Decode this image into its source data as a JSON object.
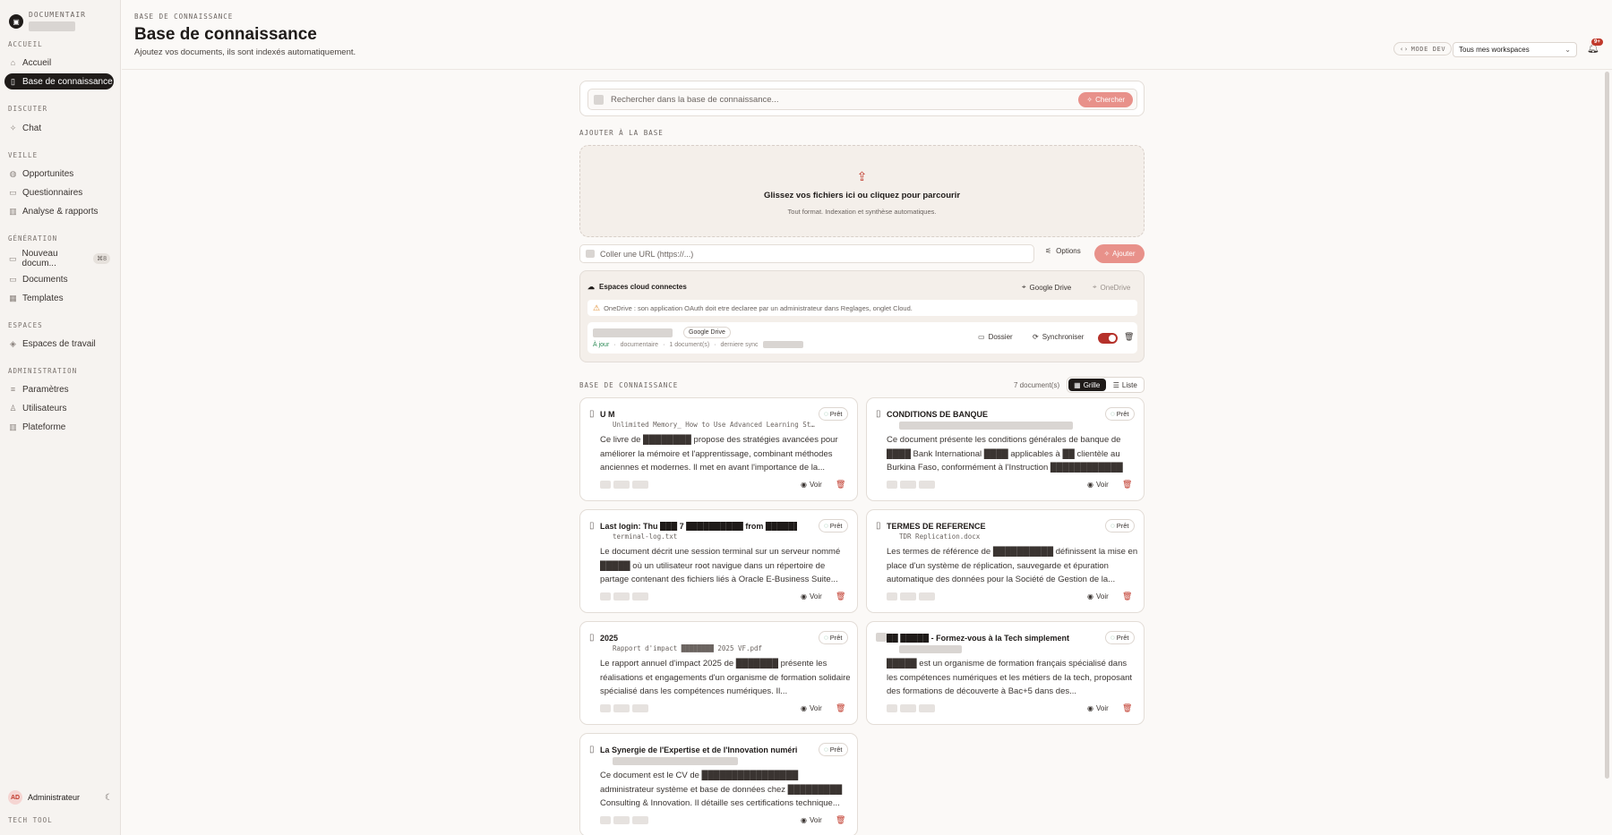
{
  "brand": {
    "name": "DOCUMENTAIR"
  },
  "sidebar": {
    "sections": [
      {
        "label": "ACCUEIL",
        "items": [
          {
            "label": "Accueil",
            "icon": "home-icon"
          },
          {
            "label": "Base de connaissance",
            "icon": "book-icon",
            "active": true
          }
        ]
      },
      {
        "label": "DISCUTER",
        "items": [
          {
            "label": "Chat",
            "icon": "sparkle-icon"
          }
        ]
      },
      {
        "label": "VEILLE",
        "items": [
          {
            "label": "Opportunites",
            "icon": "globe-icon"
          },
          {
            "label": "Questionnaires",
            "icon": "file-icon"
          },
          {
            "label": "Analyse & rapports",
            "icon": "chart-icon"
          }
        ]
      },
      {
        "label": "GÉNÉRATION",
        "items": [
          {
            "label": "Nouveau docum...",
            "icon": "doc-plus-icon",
            "badge": "⌘8"
          },
          {
            "label": "Documents",
            "icon": "file-icon"
          },
          {
            "label": "Templates",
            "icon": "template-icon"
          }
        ]
      },
      {
        "label": "ESPACES",
        "items": [
          {
            "label": "Espaces de travail",
            "icon": "layers-icon"
          }
        ]
      },
      {
        "label": "ADMINISTRATION",
        "items": [
          {
            "label": "Paramètres",
            "icon": "sliders-icon"
          },
          {
            "label": "Utilisateurs",
            "icon": "user-icon"
          },
          {
            "label": "Plateforme",
            "icon": "chart-icon"
          }
        ]
      }
    ],
    "user": {
      "initials": "AD",
      "name": "Administrateur"
    },
    "footer": "TECH TOOL"
  },
  "header": {
    "crumb": "BASE DE CONNAISSANCE",
    "title": "Base de connaissance",
    "subtitle": "Ajoutez vos documents, ils sont indexés automatiquement.",
    "mode_dev": "MODE DEV",
    "workspace": "Tous mes workspaces",
    "notif_badge": "9+"
  },
  "search": {
    "placeholder": "Rechercher dans la base de connaissance...",
    "button": "Chercher"
  },
  "add": {
    "label": "AJOUTER À LA BASE",
    "drop_title": "Glissez vos fichiers ici ou cliquez pour parcourir",
    "drop_sub": "Tout format. Indexation et synthèse automatiques.",
    "url_placeholder": "Coller une URL (https://...)",
    "options": "Options",
    "add_button": "Ajouter"
  },
  "cloud": {
    "title": "Espaces cloud connectes",
    "google_drive": "Google Drive",
    "onedrive": "OneDrive",
    "warning": "OneDrive : son application OAuth doit etre declaree par un administrateur dans Reglages, onglet Cloud.",
    "connection": {
      "tag": "Google Drive",
      "status": "À jour",
      "folder": "documentaire",
      "count": "1 document(s)",
      "last_sync": "derniere sync",
      "dossier": "Dossier",
      "sync": "Synchroniser"
    }
  },
  "kb": {
    "label": "BASE DE CONNAISSANCE",
    "count": "7 document(s)",
    "grid": "Grille",
    "list": "Liste"
  },
  "ui": {
    "badge": "Prêt",
    "voir": "Voir"
  },
  "documents": [
    {
      "title": "U M",
      "file": "Unlimited Memory_ How to Use Advanced Learning St…",
      "desc": "Ce livre de ████████ propose des stratégies avancées pour améliorer la mémoire et l'apprentissage, combinant méthodes anciennes et modernes. Il met en avant l'importance de la..."
    },
    {
      "title": "CONDITIONS DE BANQUE",
      "file": "",
      "desc": "Ce document présente les conditions générales de banque de ████ Bank International ████ applicables à ██ clientèle au Burkina Faso, conformément à l'Instruction ████████████ de..."
    },
    {
      "title": "Last login: Thu ███ 7 ██████████ from █████████",
      "file": "terminal-log.txt",
      "desc": "Le document décrit une session terminal sur un serveur nommé █████ où un utilisateur root navigue dans un répertoire de partage contenant des fichiers liés à Oracle E-Business Suite..."
    },
    {
      "title": "TERMES DE REFERENCE",
      "file": "TDR Replication.docx",
      "desc": "Les termes de référence de ██████████ définissent la mise en place d'un système de réplication, sauvegarde et épuration automatique des données pour la Société de Gestion de la..."
    },
    {
      "title": "2025",
      "file": "Rapport d'impact ████████ 2025 VF.pdf",
      "desc": "Le rapport annuel d'impact 2025 de ███████ présente les réalisations et engagements d'un organisme de formation solidaire spécialisé dans les compétences numériques. Il..."
    },
    {
      "title": "██ █████ - Formez-vous à la Tech simplement",
      "file": "",
      "desc": "█████ est un organisme de formation français spécialisé dans les compétences numériques et les métiers de la tech, proposant des formations de découverte à Bac+5 dans des..."
    },
    {
      "title": "La Synergie de l'Expertise et de l'Innovation numérique",
      "file": "",
      "desc": "Ce document est le CV de ████████████████ administrateur système et base de données chez █████████ Consulting & Innovation. Il détaille ses certifications technique..."
    }
  ]
}
